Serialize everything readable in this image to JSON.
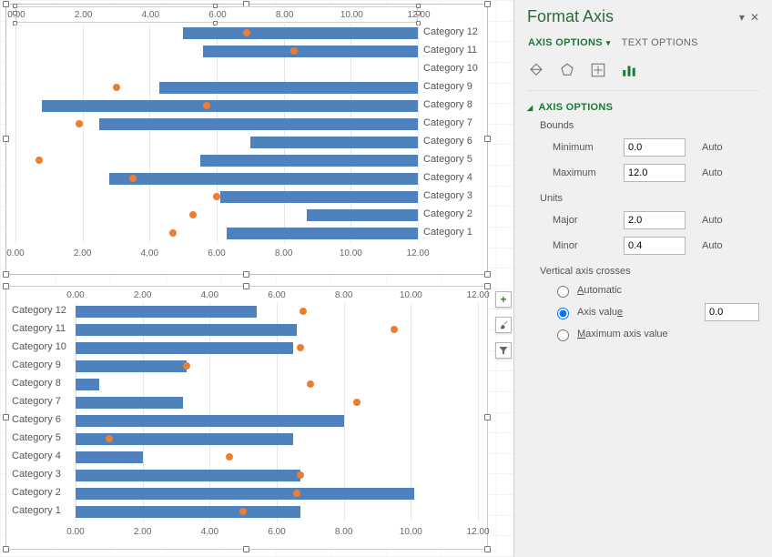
{
  "panel": {
    "title": "Format Axis",
    "tabs": {
      "axis_options": "AXIS OPTIONS",
      "text_options": "TEXT OPTIONS"
    },
    "icons": {
      "fill": "fill-bucket-icon",
      "effects": "pentagon-icon",
      "size": "size-props-icon",
      "axis": "bar-chart-icon"
    },
    "section": "AXIS OPTIONS",
    "bounds_label": "Bounds",
    "min_label": "Minimum",
    "max_label": "Maximum",
    "units_label": "Units",
    "major_label": "Major",
    "minor_label": "Minor",
    "auto_label": "Auto",
    "crosses_label": "Vertical axis crosses",
    "radio_auto": "Automatic",
    "radio_value": "Axis value",
    "radio_max": "Maximum axis value",
    "min_val": "0.0",
    "max_val": "12.0",
    "major_val": "2.0",
    "minor_val": "0.4",
    "cross_val": "0.0"
  },
  "side_buttons": {
    "plus": "+",
    "brush": "brush-icon",
    "filter": "funnel-icon"
  },
  "axis_ticks": [
    "0.00",
    "2.00",
    "4.00",
    "6.00",
    "8.00",
    "10.00",
    "12.00"
  ],
  "chart_data": [
    {
      "id": "chart_top",
      "type": "bar",
      "orientation": "horizontal",
      "x_axis": {
        "min": 0,
        "max": 12,
        "major": 2,
        "position_top": true,
        "position_bottom": true
      },
      "category_label_side": "right",
      "categories": [
        "Category 12",
        "Category 11",
        "Category 10",
        "Category 9",
        "Category 8",
        "Category 7",
        "Category 6",
        "Category 5",
        "Category 4",
        "Category 3",
        "Category 2",
        "Category 1"
      ],
      "series": [
        {
          "name": "bars",
          "type": "bar_range",
          "color": "#4f81bd",
          "ranges": [
            [
              5.0,
              12.0
            ],
            [
              5.6,
              12.0
            ],
            [
              12.0,
              12.0
            ],
            [
              4.3,
              12.0
            ],
            [
              0.8,
              12.0
            ],
            [
              2.5,
              12.0
            ],
            [
              7.0,
              12.0
            ],
            [
              5.5,
              12.0
            ],
            [
              2.8,
              12.0
            ],
            [
              6.1,
              12.0
            ],
            [
              8.7,
              12.0
            ],
            [
              6.3,
              12.0
            ]
          ]
        },
        {
          "name": "markers",
          "type": "scatter",
          "color": "#ed7d31",
          "x": [
            6.9,
            8.3,
            null,
            3.0,
            5.7,
            1.9,
            null,
            null,
            3.5,
            6.0,
            5.3,
            4.7
          ],
          "x2": [
            null,
            null,
            null,
            null,
            null,
            null,
            null,
            0.7,
            null,
            null,
            null,
            null
          ]
        }
      ]
    },
    {
      "id": "chart_bottom",
      "type": "bar",
      "orientation": "horizontal",
      "x_axis": {
        "min": 0,
        "max": 12,
        "major": 2,
        "position_top": true,
        "position_bottom": true
      },
      "category_label_side": "left",
      "categories": [
        "Category 12",
        "Category 11",
        "Category 10",
        "Category 9",
        "Category 8",
        "Category 7",
        "Category 6",
        "Category 5",
        "Category 4",
        "Category 3",
        "Category 2",
        "Category 1"
      ],
      "series": [
        {
          "name": "bars",
          "type": "bar",
          "color": "#4f81bd",
          "values": [
            5.4,
            6.6,
            6.5,
            3.3,
            0.7,
            3.2,
            8.0,
            6.5,
            2.0,
            6.7,
            10.1,
            6.7
          ]
        },
        {
          "name": "markers",
          "type": "scatter",
          "color": "#ed7d31",
          "x": [
            6.8,
            9.5,
            6.7,
            3.3,
            7.0,
            8.4,
            null,
            1.0,
            4.6,
            6.7,
            6.6,
            5.0
          ]
        }
      ]
    }
  ]
}
